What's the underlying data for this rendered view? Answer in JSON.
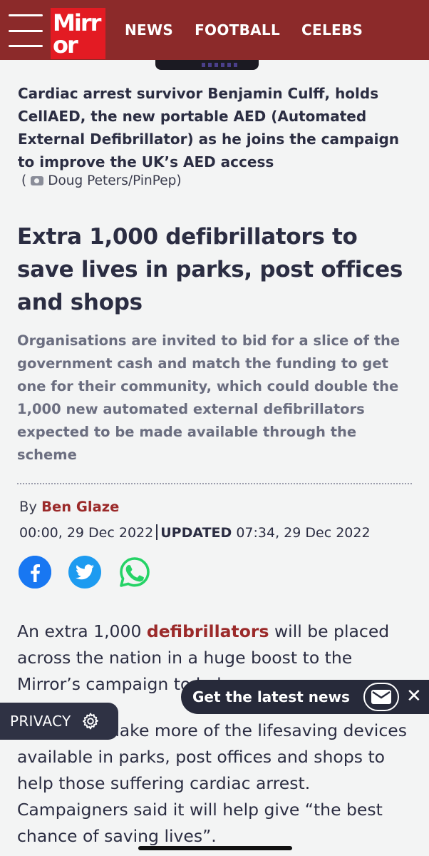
{
  "header": {
    "logo_line1": "Mirr",
    "logo_line2": "or",
    "nav": [
      "NEWS",
      "FOOTBALL",
      "CELEBS"
    ]
  },
  "image": {
    "caption": "Cardiac arrest survivor Benjamin Culff, holds CellAED, the new portable AED (Automated External Defibrillator) as he joins the campaign to improve the UK’s AED access",
    "credit_open": "(",
    "credit": "Doug Peters/PinPep)"
  },
  "article": {
    "headline": "Extra 1,000 defibrillators to save lives in parks, post offices and shops",
    "standfirst": "Organisations are invited to bid for a slice of the government cash and match the funding to get one for their community, which could double the 1,000 new automated external defibrillators expected to be made available through the scheme",
    "byline_prefix": "By ",
    "author": "Ben Glaze",
    "published": "00:00, 29 Dec 2022",
    "updated_label": "UPDATED",
    "updated": "07:34, 29 Dec 2022",
    "p1_before": "An extra 1,000 ",
    "p1_link": "defibrillators",
    "p1_after": " will be placed across the nation in a huge boost to the Mirror’s campaign to hel",
    "p2": "   und will make more of the lifesaving devices available in parks, post offices and shops to help those suffering cardiac arrest. Campaigners said it will help give “the best chance of saving lives”."
  },
  "share": {
    "icons": [
      "facebook-icon",
      "twitter-icon",
      "whatsapp-icon"
    ]
  },
  "news_bar": {
    "label": "Get the latest news",
    "close": "✕"
  },
  "privacy": {
    "label": "PRIVACY"
  },
  "colors": {
    "header_bg": "#8c2a2a",
    "logo_bg": "#e31b23",
    "accent_red": "#9b2a2a",
    "text_dark": "#2b2d42",
    "facebook": "#1877f2",
    "twitter": "#1d9bf0",
    "whatsapp": "#25d366"
  }
}
